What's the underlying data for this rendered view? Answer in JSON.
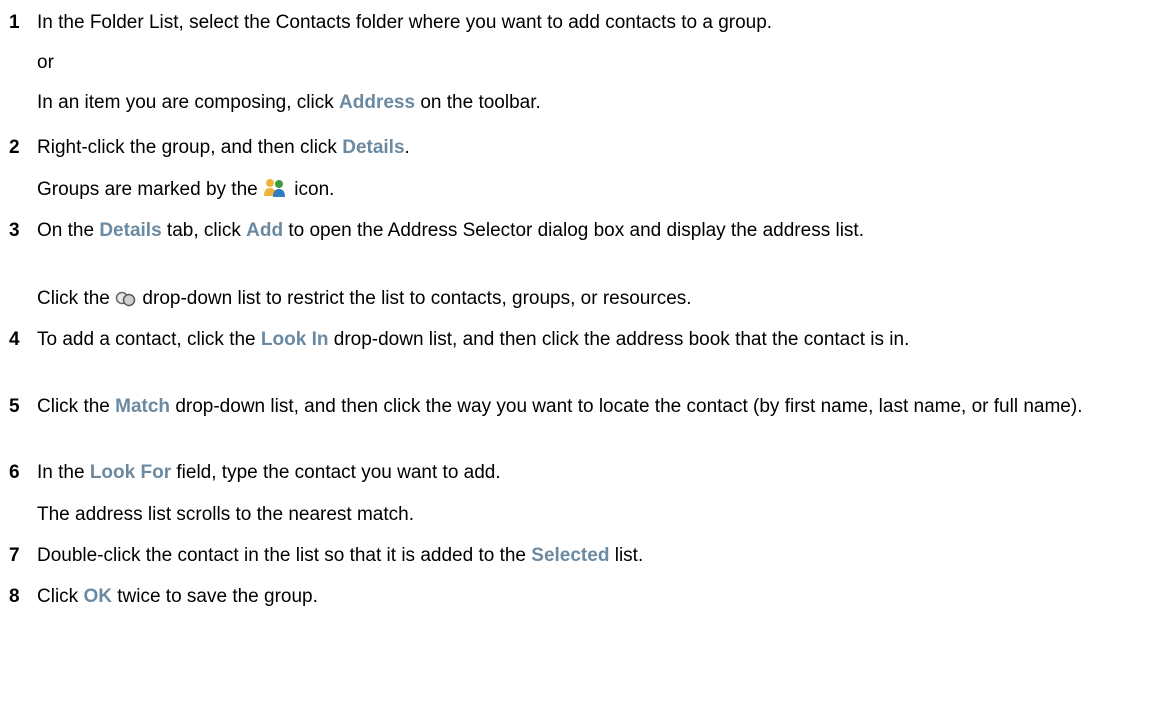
{
  "steps": [
    {
      "num": "1",
      "text": "In the Folder List, select the Contacts folder where you want to add contacts to a group."
    },
    {
      "num": "2",
      "a": "Right-click the group, and then click ",
      "b": "Details",
      "c": "."
    },
    {
      "num": "3",
      "a": "On the ",
      "b": "Details",
      "c": " tab, click ",
      "d": "Add",
      "e": " to open the Address Selector dialog box and display the address list."
    },
    {
      "num": "4",
      "a": "To add a contact, click the ",
      "b": "Look In",
      "c": " drop-down list, and then click the address book that the contact is in."
    },
    {
      "num": "5",
      "a": "Click the ",
      "b": "Match",
      "c": " drop-down list, and then click the way you want to locate the contact (by first name, last name, or full name)."
    },
    {
      "num": "6",
      "a": "In the ",
      "b": "Look For",
      "c": " field, type the contact you want to add."
    },
    {
      "num": "7",
      "a": "Double-click the contact in the list so that it is added to the ",
      "b": "Selected",
      "c": " list."
    },
    {
      "num": "8",
      "a": "Click ",
      "b": "OK",
      "c": " twice to save the group."
    }
  ],
  "notes": {
    "or": "or",
    "compose_a": "In an item you are composing, click ",
    "compose_b": "Address",
    "compose_c": " on the toolbar.",
    "groups_a": "Groups are marked by the ",
    "groups_c": " icon.",
    "dropdown_a": "Click the ",
    "dropdown_c": " drop-down list to restrict the list to contacts, groups, or resources.",
    "scroll": "The address list scrolls to the nearest match."
  },
  "icons": {
    "group_icon": "group-icon",
    "filter_icon": "filter-dropdown-icon"
  }
}
